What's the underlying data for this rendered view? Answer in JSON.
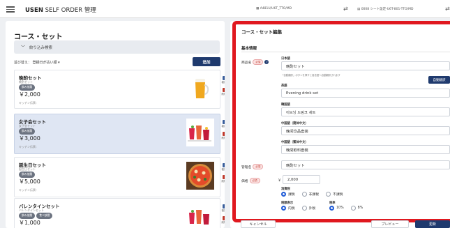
{
  "topbar": {
    "brand": "USEN",
    "brand_sub": " SELF ORDER 管理",
    "device": "A481U/U6T_TTO/MD",
    "seat": "0008 シート設定-U6T-801-TTO/MD"
  },
  "left": {
    "title": "コース・セット",
    "filter_label": "絞り込み検索",
    "sort_label": "並び替え： 登録日が古い順",
    "add_label": "追加",
    "copy_label": "複製",
    "delete_label": "削除",
    "items": [
      {
        "name": "晩酌セット",
        "kana": "晩酌セット",
        "badges": [
          "飲み放題"
        ],
        "price": "￥2,000",
        "kitchen": "キッチン伝票：",
        "image": "beer"
      },
      {
        "name": "女子会セット",
        "kana": "女子会セット",
        "badges": [
          "飲み放題"
        ],
        "price": "￥3,000",
        "kitchen": "キッチン伝票：",
        "image": "cocktails"
      },
      {
        "name": "誕生日セット",
        "kana": "誕生日セット",
        "badges": [
          "飲み放題"
        ],
        "price": "￥5,000",
        "kitchen": "キッチン伝票：",
        "image": "pizza"
      },
      {
        "name": "バレンタインセット",
        "kana": "バレンタインセット",
        "badges": [
          "飲み放題",
          "食べ放題"
        ],
        "price": "￥1,000",
        "kitchen": "",
        "image": "cocktails"
      }
    ]
  },
  "right": {
    "title": "コース・セット編集",
    "section": "基本情報",
    "product_name_label": "商品名",
    "required": "必須",
    "help": "?",
    "ja_label": "日本語",
    "ja_value": "晩酌セット",
    "auto_note": "「自動翻訳」ボタンを押すと各言語へ自動翻訳されます",
    "auto_translate": "自動翻訳",
    "en_label": "英語",
    "en_value": "Evening drink set",
    "ko_label": "韓国語",
    "ko_value": "이브닝 드링크 세트",
    "zh_s_label": "中国語（簡体中文）",
    "zh_s_value": "晚间饮品套装",
    "zh_t_label": "中国語（繁体中文）",
    "zh_t_value": "晚間飲料套裝",
    "mgmt_label": "管理名",
    "mgmt_value": "晩酌セット",
    "price_label": "価格",
    "yen": "￥",
    "price_value": "2,000",
    "tax_label": "消費税",
    "tax_options": [
      "課税",
      "非課税",
      "不課税"
    ],
    "tax_type_label": "税額表示",
    "tax_type_options": [
      "内税",
      "外税"
    ],
    "rate_label": "税率",
    "rate_options": [
      "10%",
      "8%"
    ]
  },
  "footer": {
    "cancel": "キャンセル",
    "preview": "プレビュー",
    "update": "更新"
  },
  "colors": {
    "accent": "#1f3a6e",
    "highlight": "#e0181f",
    "selected": "#dfe6f3"
  }
}
